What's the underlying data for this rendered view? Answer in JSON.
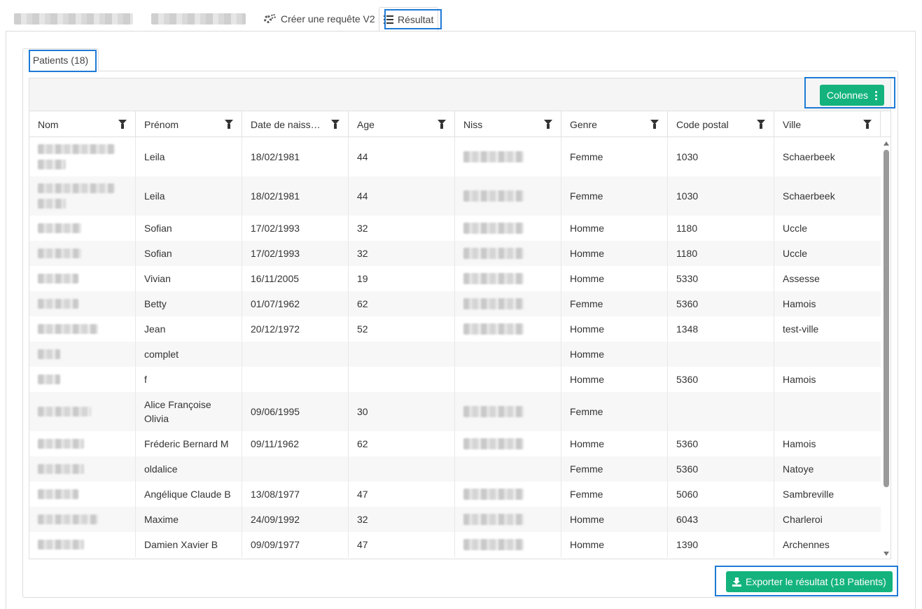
{
  "top_tabs": [
    {
      "label": "",
      "blurred": true
    },
    {
      "label": "",
      "blurred": true
    },
    {
      "label": "Créer une requête V2",
      "icon": "gears-icon"
    },
    {
      "label": "Résultat",
      "icon": "list-icon",
      "active": true
    }
  ],
  "sub_tab": {
    "label": "Patients (18)"
  },
  "toolbar": {
    "columns_button": "Colonnes"
  },
  "columns": [
    "Nom",
    "Prénom",
    "Date de naissance",
    "Age",
    "Niss",
    "Genre",
    "Code postal",
    "Ville"
  ],
  "rows": [
    {
      "prenom": "Leila",
      "date": "18/02/1981",
      "age": "44",
      "genre": "Femme",
      "cp": "1030",
      "ville": "Schaerbeek"
    },
    {
      "prenom": "Leila",
      "date": "18/02/1981",
      "age": "44",
      "genre": "Femme",
      "cp": "1030",
      "ville": "Schaerbeek"
    },
    {
      "prenom": "Sofian",
      "date": "17/02/1993",
      "age": "32",
      "genre": "Homme",
      "cp": "1180",
      "ville": "Uccle"
    },
    {
      "prenom": "Sofian",
      "date": "17/02/1993",
      "age": "32",
      "genre": "Homme",
      "cp": "1180",
      "ville": "Uccle"
    },
    {
      "prenom": "Vivian",
      "date": "16/11/2005",
      "age": "19",
      "genre": "Homme",
      "cp": "5330",
      "ville": "Assesse"
    },
    {
      "prenom": "Betty",
      "date": "01/07/1962",
      "age": "62",
      "genre": "Femme",
      "cp": "5360",
      "ville": "Hamois"
    },
    {
      "prenom": "Jean",
      "date": "20/12/1972",
      "age": "52",
      "genre": "Homme",
      "cp": "1348",
      "ville": "test-ville"
    },
    {
      "prenom": "complet",
      "date": "",
      "age": "",
      "genre": "Homme",
      "cp": "",
      "ville": ""
    },
    {
      "prenom": "f",
      "date": "",
      "age": "",
      "genre": "Homme",
      "cp": "5360",
      "ville": "Hamois"
    },
    {
      "prenom": "Alice Françoise Olivia",
      "date": "09/06/1995",
      "age": "30",
      "genre": "Femme",
      "cp": "",
      "ville": ""
    },
    {
      "prenom": "Fréderic Bernard M",
      "date": "09/11/1962",
      "age": "62",
      "genre": "Homme",
      "cp": "5360",
      "ville": "Hamois"
    },
    {
      "prenom": "oldalice",
      "date": "",
      "age": "",
      "genre": "Femme",
      "cp": "5360",
      "ville": "Natoye"
    },
    {
      "prenom": "Angélique Claude B",
      "date": "13/08/1977",
      "age": "47",
      "genre": "Femme",
      "cp": "5060",
      "ville": "Sambreville"
    },
    {
      "prenom": "Maxime",
      "date": "24/09/1992",
      "age": "32",
      "genre": "Homme",
      "cp": "6043",
      "ville": "Charleroi"
    },
    {
      "prenom": "Damien Xavier B",
      "date": "09/09/1977",
      "age": "47",
      "genre": "Homme",
      "cp": "1390",
      "ville": "Archennes"
    }
  ],
  "export_button": "Exporter le résultat (18 Patients)",
  "colors": {
    "accent": "#14b37d",
    "focus": "#1e7ad6"
  }
}
